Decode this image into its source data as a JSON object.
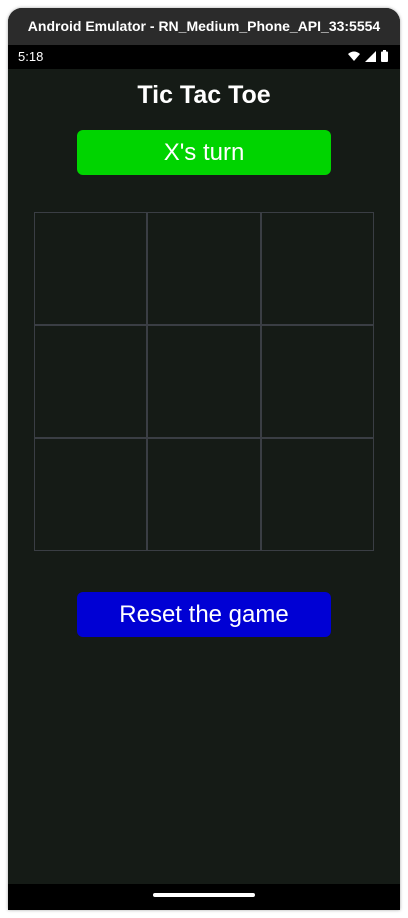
{
  "window": {
    "title": "Android Emulator - RN_Medium_Phone_API_33:5554"
  },
  "status_bar": {
    "time": "5:18",
    "icons": [
      "wifi-icon",
      "cellular-signal-icon",
      "battery-icon"
    ]
  },
  "app": {
    "title": "Tic Tac Toe",
    "turn_text": "X's turn",
    "reset_label": "Reset the game",
    "board": [
      [
        "",
        "",
        ""
      ],
      [
        "",
        "",
        ""
      ],
      [
        "",
        "",
        ""
      ]
    ]
  },
  "colors": {
    "background": "#151b16",
    "turn_banner": "#00d400",
    "reset_button": "#0000d4",
    "cell_border": "#3a3e44",
    "text": "#ffffff"
  }
}
